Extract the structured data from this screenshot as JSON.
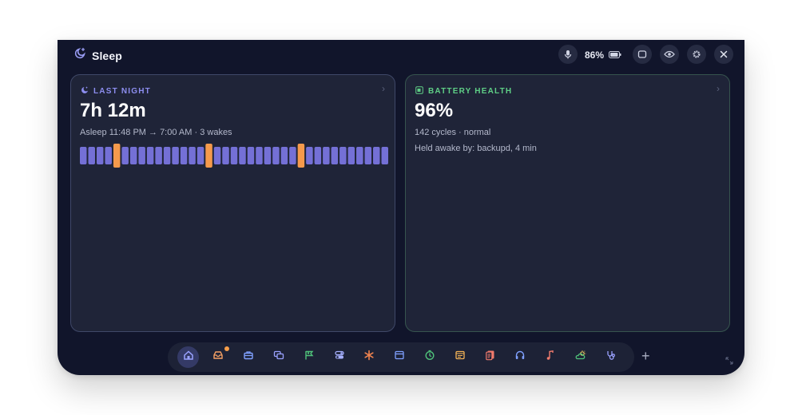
{
  "window": {
    "title": "Sleep",
    "title_icon": "moon-sparkle-icon"
  },
  "controls": {
    "mic_icon": "microphone-icon",
    "battery_percent": "86%",
    "battery_icon": "battery-icon",
    "window_icon": "window-icon",
    "eye_icon": "eye-icon",
    "settings_icon": "gear-icon",
    "close_icon": "close-icon"
  },
  "last_night": {
    "label": "LAST NIGHT",
    "duration": "7h 12m",
    "summary": "Asleep 11:48 PM → 7:00 AM · 3 wakes",
    "chevron": "›",
    "segments": [
      "sleep",
      "sleep",
      "sleep",
      "sleep",
      "awake",
      "sleep",
      "sleep",
      "sleep",
      "sleep",
      "sleep",
      "sleep",
      "sleep",
      "sleep",
      "sleep",
      "sleep",
      "awake",
      "sleep",
      "sleep",
      "sleep",
      "sleep",
      "sleep",
      "sleep",
      "sleep",
      "sleep",
      "sleep",
      "sleep",
      "awake",
      "sleep",
      "sleep",
      "sleep",
      "sleep",
      "sleep",
      "sleep",
      "sleep",
      "sleep",
      "sleep",
      "sleep"
    ],
    "colors": {
      "sleep": "#7470d6",
      "awake": "#f59a4c"
    }
  },
  "battery_health": {
    "label": "BATTERY HEALTH",
    "value": "96%",
    "cycles": "142 cycles · normal",
    "held_awake": "Held awake by: backupd, 4 min",
    "chevron": "›"
  },
  "dock": {
    "items": [
      {
        "icon": "home-icon",
        "color": "#9aa2ff",
        "active": true
      },
      {
        "icon": "inbox-icon",
        "color": "#f5a064",
        "badge": true
      },
      {
        "icon": "briefcase-icon",
        "color": "#7fa0ff"
      },
      {
        "icon": "chat-icon",
        "color": "#9aa2ff"
      },
      {
        "icon": "flag-icon",
        "color": "#4fc27a"
      },
      {
        "icon": "toggles-icon",
        "color": "#a6b0ff"
      },
      {
        "icon": "asterisk-icon",
        "color": "#f0834f"
      },
      {
        "icon": "calendar-icon",
        "color": "#7fa0ff"
      },
      {
        "icon": "timer-icon",
        "color": "#4fc27a"
      },
      {
        "icon": "notes-icon",
        "color": "#f3b256"
      },
      {
        "icon": "cards-icon",
        "color": "#f07a6c"
      },
      {
        "icon": "headphones-icon",
        "color": "#7fa0ff"
      },
      {
        "icon": "music-note-icon",
        "color": "#f07a6c"
      },
      {
        "icon": "weather-icon",
        "color": "#e8c462"
      },
      {
        "icon": "stethoscope-icon",
        "color": "#9aa2ff"
      }
    ],
    "add_label": "+"
  }
}
